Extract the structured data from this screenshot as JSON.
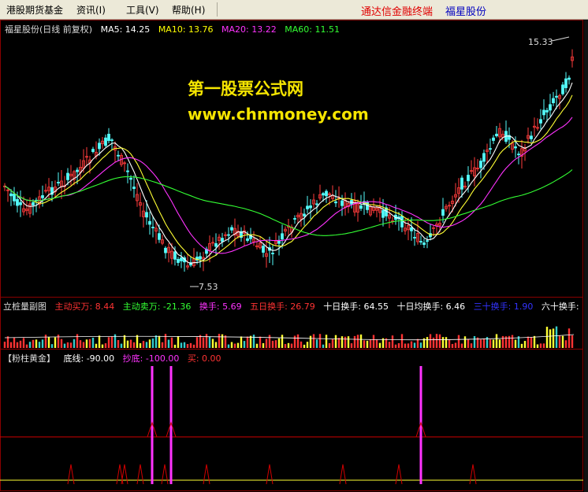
{
  "menubar": {
    "items": [
      {
        "label": "港股期货基金"
      },
      {
        "label": "资讯(I)"
      },
      {
        "label": "工具(V)"
      },
      {
        "label": "帮助(H)"
      }
    ],
    "brand_left": "通达信金融终端",
    "brand_right": "福星股份"
  },
  "main_panel": {
    "title": "福星股份(日线 前复权)",
    "ma": [
      {
        "label": "MA5: 14.25",
        "color": "#ffffff"
      },
      {
        "label": "MA10: 13.76",
        "color": "#ffff00"
      },
      {
        "label": "MA20: 13.22",
        "color": "#ff33ff"
      },
      {
        "label": "MA60: 11.51",
        "color": "#33ff33"
      }
    ],
    "high_label": "15.33",
    "low_label": "7.53",
    "watermark_title": "第一股票公式网",
    "watermark_url": "www.chnmoney.com",
    "right_marker": "1"
  },
  "volume_panel": {
    "title": "立桩量副图",
    "items": [
      {
        "label": "主动买万: 8.44",
        "color": "#ff3333"
      },
      {
        "label": "主动卖万: -21.36",
        "color": "#33ff33"
      },
      {
        "label": "换手: 5.69",
        "color": "#ff33ff"
      },
      {
        "label": "五日换手: 26.79",
        "color": "#ff3333"
      },
      {
        "label": "十日换手: 64.55",
        "color": "#ffffff"
      },
      {
        "label": "十日均换手: 6.46",
        "color": "#ffffff"
      },
      {
        "label": "三十换手: 1.90",
        "color": "#3333ff"
      },
      {
        "label": "六十换手:",
        "color": "#ffffff"
      }
    ]
  },
  "signal_panel": {
    "title": "【粉柱黄金】",
    "items": [
      {
        "label": "底线: -90.00",
        "color": "#ffffff"
      },
      {
        "label": "抄底: -100.00",
        "color": "#ff33ff"
      },
      {
        "label": "买: 0.00",
        "color": "#ff3333"
      }
    ]
  }
}
